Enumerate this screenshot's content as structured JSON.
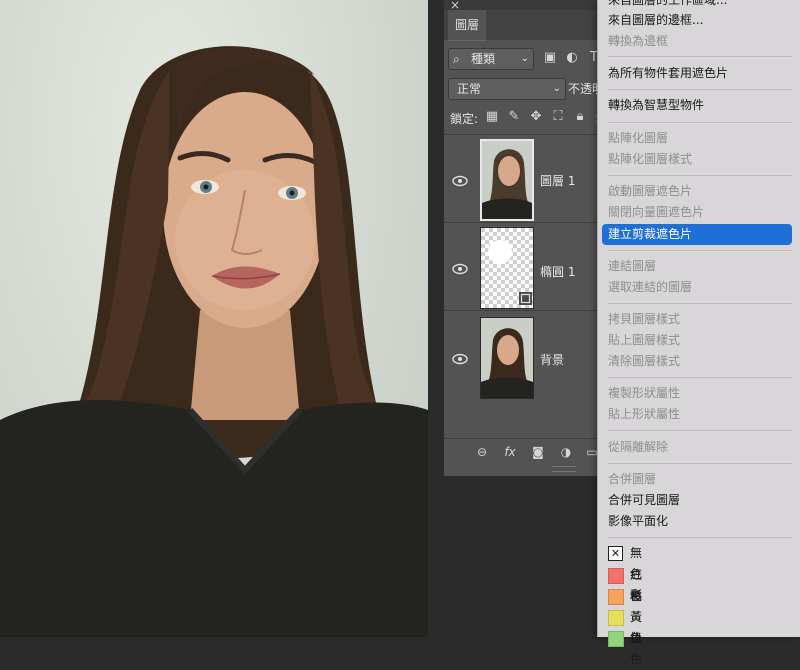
{
  "layers_panel": {
    "tab_label": "圖層",
    "filter_kind": "種類",
    "blend_mode": "正常",
    "opacity_label": "不透明",
    "lock_label": "鎖定:",
    "layers": [
      {
        "name": "圖層 1"
      },
      {
        "name": "橢圓 1"
      },
      {
        "name": "背景"
      }
    ]
  },
  "context_menu": {
    "items": [
      {
        "label": "來自圖層的工作區域...",
        "enabled": true
      },
      {
        "label": "來自圖層的邊框...",
        "enabled": true
      },
      {
        "label": "轉換為邊框",
        "enabled": false
      },
      {
        "label": "為所有物件套用遮色片",
        "enabled": true
      },
      {
        "label": "轉換為智慧型物件",
        "enabled": true
      },
      {
        "label": "點陣化圖層",
        "enabled": false
      },
      {
        "label": "點陣化圖層樣式",
        "enabled": false
      },
      {
        "label": "啟動圖層遮色片",
        "enabled": false
      },
      {
        "label": "關閉向量圖遮色片",
        "enabled": false
      },
      {
        "label": "建立剪裁遮色片",
        "enabled": true,
        "highlighted": true
      },
      {
        "label": "連結圖層",
        "enabled": false
      },
      {
        "label": "選取連結的圖層",
        "enabled": false
      },
      {
        "label": "拷貝圖層樣式",
        "enabled": false
      },
      {
        "label": "貼上圖層樣式",
        "enabled": false
      },
      {
        "label": "清除圖層樣式",
        "enabled": false
      },
      {
        "label": "複製形狀屬性",
        "enabled": false
      },
      {
        "label": "貼上形狀屬性",
        "enabled": false
      },
      {
        "label": "從隔離解除",
        "enabled": false
      },
      {
        "label": "合併圖層",
        "enabled": false
      },
      {
        "label": "合併可見圖層",
        "enabled": true
      },
      {
        "label": "影像平面化",
        "enabled": true
      }
    ],
    "colors": [
      {
        "label": "無色彩",
        "color": "none"
      },
      {
        "label": "紅色",
        "color": "#f4706c"
      },
      {
        "label": "橘黃色",
        "color": "#f6a45a"
      },
      {
        "label": "黃色",
        "color": "#e8df5c"
      },
      {
        "label": "綠色",
        "color": "#8fd67a"
      }
    ]
  },
  "colors": {
    "panel_bg": "#535353",
    "menu_bg": "#d8d6d8",
    "highlight": "#1f6fd6"
  }
}
